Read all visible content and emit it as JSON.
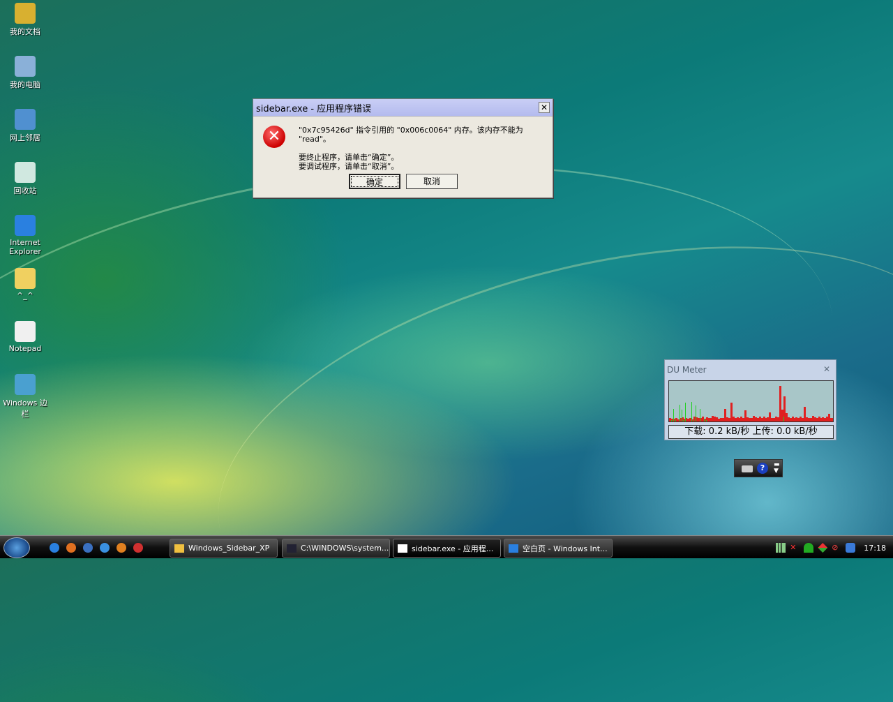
{
  "desktop_icons": [
    {
      "label": "我的文档",
      "icon": "my-documents-icon",
      "color": "#d8b030"
    },
    {
      "label": "我的电脑",
      "icon": "my-computer-icon",
      "color": "#8ab0d8"
    },
    {
      "label": "网上邻居",
      "icon": "network-icon",
      "color": "#5090d0"
    },
    {
      "label": "回收站",
      "icon": "recycle-bin-icon",
      "color": "#d0e8e0"
    },
    {
      "label": "Internet Explorer",
      "icon": "internet-explorer-icon",
      "color": "#2a80e0"
    },
    {
      "label": "^_^",
      "icon": "folder-icon",
      "color": "#f0d060"
    },
    {
      "label": "Notepad",
      "icon": "notepad-icon",
      "color": "#f0f0f0"
    },
    {
      "label": "Windows 边栏",
      "icon": "windows-sidebar-icon",
      "color": "#4aa0d0"
    }
  ],
  "dialog": {
    "title": "sidebar.exe - 应用程序错误",
    "close": "✕",
    "icon": "error-icon",
    "line1": "\"0x7c95426d\" 指令引用的 \"0x006c0064\" 内存。该内存不能为 \"read\"。",
    "line2": "要终止程序，请单击“确定”。",
    "line3": "要调试程序，请单击“取消”。",
    "ok": "确定",
    "cancel": "取消"
  },
  "du_meter": {
    "title": "DU Meter",
    "close": "✕",
    "status": "下载: 0.2 kB/秒  上传: 0.0 kB/秒",
    "download_samples": [
      8,
      6,
      7,
      9,
      5,
      8,
      10,
      6,
      9,
      7,
      8,
      5,
      12,
      10,
      9,
      8,
      11,
      7,
      10,
      8,
      9,
      14,
      12,
      10,
      7,
      9,
      8,
      30,
      10,
      9,
      45,
      12,
      9,
      10,
      8,
      11,
      9,
      26,
      10,
      8,
      9,
      14,
      10,
      8,
      12,
      9,
      11,
      8,
      10,
      22,
      9,
      8,
      11,
      10,
      85,
      28,
      60,
      20,
      10,
      9,
      12,
      8,
      10,
      9,
      11,
      8,
      35,
      10,
      9,
      8,
      13,
      10,
      9,
      11,
      8,
      10,
      9,
      12,
      18,
      9,
      8
    ],
    "upload_samples": [
      2,
      4,
      30,
      5,
      2,
      40,
      28,
      3,
      45,
      2,
      2,
      46,
      3,
      38,
      2,
      30,
      2,
      6,
      4,
      2,
      2,
      2,
      2,
      2,
      2,
      2,
      2,
      2,
      2,
      2,
      2,
      2,
      2,
      2,
      2,
      2,
      2,
      2,
      2,
      2,
      2,
      2,
      2,
      2,
      2,
      2,
      2,
      2,
      2,
      2,
      2,
      2,
      2,
      2,
      2,
      2,
      12,
      2,
      2,
      2,
      2,
      2,
      2,
      2,
      2,
      2,
      2,
      2,
      2,
      2,
      2,
      2,
      2,
      2,
      2,
      2,
      2,
      2,
      2,
      2,
      2
    ]
  },
  "taskbar": {
    "quick_launch": [
      "internet-explorer-icon",
      "firefox-icon",
      "show-desktop-icon",
      "ie-alt-icon",
      "media-player-icon",
      "google-icon"
    ],
    "tasks": [
      {
        "label": "Windows_Sidebar_XP",
        "icon": "folder-icon"
      },
      {
        "label": "C:\\WINDOWS\\system...",
        "icon": "cmd-icon"
      },
      {
        "label": "sidebar.exe - 应用程...",
        "icon": "window-icon"
      },
      {
        "label": "空白页 - Windows Int...",
        "icon": "internet-explorer-icon"
      }
    ],
    "clock": "17:18"
  }
}
